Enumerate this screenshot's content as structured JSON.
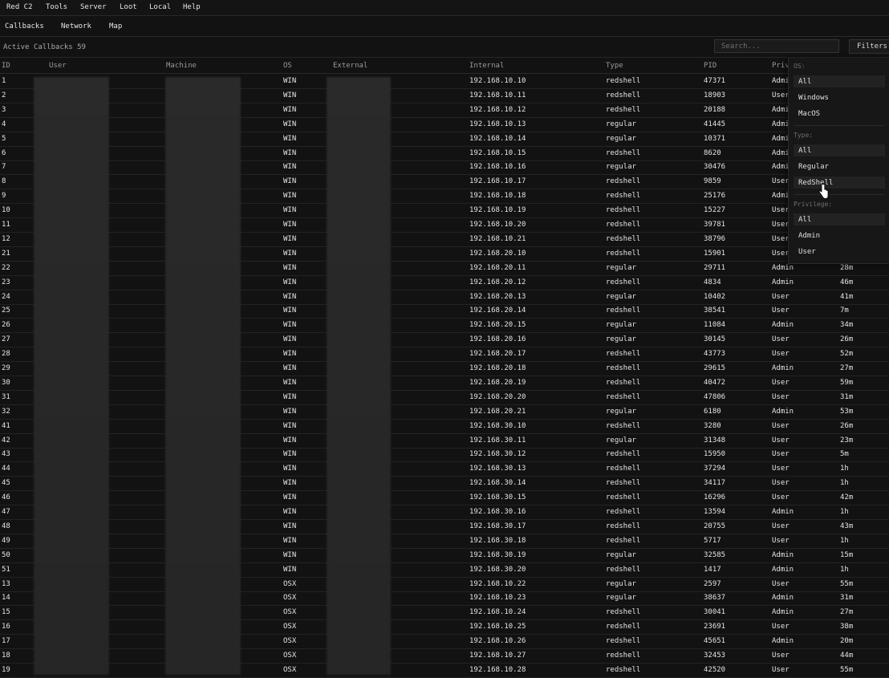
{
  "menu": [
    "Red C2",
    "Tools",
    "Server",
    "Loot",
    "Local",
    "Help"
  ],
  "tabs": [
    "Callbacks",
    "Network",
    "Map"
  ],
  "toolbar": {
    "active_label": "Active Callbacks 59",
    "search_placeholder": "Search...",
    "filters_label": "Filters"
  },
  "columns": [
    "ID",
    "User",
    "Machine",
    "OS",
    "External",
    "Internal",
    "Type",
    "PID",
    "Priv"
  ],
  "rows": [
    [
      "1",
      "WIN",
      "192.168.10.10",
      "redshell",
      "47371",
      "Admi",
      ""
    ],
    [
      "2",
      "WIN",
      "192.168.10.11",
      "redshell",
      "18903",
      "User",
      ""
    ],
    [
      "3",
      "WIN",
      "192.168.10.12",
      "redshell",
      "20188",
      "Admi",
      ""
    ],
    [
      "4",
      "WIN",
      "192.168.10.13",
      "regular",
      "41445",
      "Admi",
      ""
    ],
    [
      "5",
      "WIN",
      "192.168.10.14",
      "regular",
      "10371",
      "Admi",
      ""
    ],
    [
      "6",
      "WIN",
      "192.168.10.15",
      "redshell",
      "8620",
      "Admi",
      ""
    ],
    [
      "7",
      "WIN",
      "192.168.10.16",
      "regular",
      "30476",
      "Admi",
      ""
    ],
    [
      "8",
      "WIN",
      "192.168.10.17",
      "redshell",
      "9859",
      "User",
      ""
    ],
    [
      "9",
      "WIN",
      "192.168.10.18",
      "redshell",
      "25176",
      "Admi",
      ""
    ],
    [
      "10",
      "WIN",
      "192.168.10.19",
      "redshell",
      "15227",
      "User",
      ""
    ],
    [
      "11",
      "WIN",
      "192.168.10.20",
      "redshell",
      "39781",
      "User",
      ""
    ],
    [
      "12",
      "WIN",
      "192.168.10.21",
      "redshell",
      "38796",
      "User",
      ""
    ],
    [
      "21",
      "WIN",
      "192.168.20.10",
      "redshell",
      "15901",
      "User",
      ""
    ],
    [
      "22",
      "WIN",
      "192.168.20.11",
      "regular",
      "29711",
      "Admin",
      "28m"
    ],
    [
      "23",
      "WIN",
      "192.168.20.12",
      "redshell",
      "4834",
      "Admin",
      "46m"
    ],
    [
      "24",
      "WIN",
      "192.168.20.13",
      "regular",
      "10402",
      "User",
      "41m"
    ],
    [
      "25",
      "WIN",
      "192.168.20.14",
      "redshell",
      "38541",
      "User",
      "7m"
    ],
    [
      "26",
      "WIN",
      "192.168.20.15",
      "regular",
      "11084",
      "Admin",
      "34m"
    ],
    [
      "27",
      "WIN",
      "192.168.20.16",
      "regular",
      "30145",
      "User",
      "26m"
    ],
    [
      "28",
      "WIN",
      "192.168.20.17",
      "redshell",
      "43773",
      "User",
      "52m"
    ],
    [
      "29",
      "WIN",
      "192.168.20.18",
      "redshell",
      "29615",
      "Admin",
      "27m"
    ],
    [
      "30",
      "WIN",
      "192.168.20.19",
      "redshell",
      "40472",
      "User",
      "59m"
    ],
    [
      "31",
      "WIN",
      "192.168.20.20",
      "redshell",
      "47806",
      "User",
      "31m"
    ],
    [
      "32",
      "WIN",
      "192.168.20.21",
      "regular",
      "6180",
      "Admin",
      "53m"
    ],
    [
      "41",
      "WIN",
      "192.168.30.10",
      "redshell",
      "3280",
      "User",
      "26m"
    ],
    [
      "42",
      "WIN",
      "192.168.30.11",
      "regular",
      "31348",
      "User",
      "23m"
    ],
    [
      "43",
      "WIN",
      "192.168.30.12",
      "redshell",
      "15950",
      "User",
      "5m"
    ],
    [
      "44",
      "WIN",
      "192.168.30.13",
      "redshell",
      "37294",
      "User",
      "1h"
    ],
    [
      "45",
      "WIN",
      "192.168.30.14",
      "redshell",
      "34117",
      "User",
      "1h"
    ],
    [
      "46",
      "WIN",
      "192.168.30.15",
      "redshell",
      "16296",
      "User",
      "42m"
    ],
    [
      "47",
      "WIN",
      "192.168.30.16",
      "redshell",
      "13594",
      "Admin",
      "1h"
    ],
    [
      "48",
      "WIN",
      "192.168.30.17",
      "redshell",
      "20755",
      "User",
      "43m"
    ],
    [
      "49",
      "WIN",
      "192.168.30.18",
      "redshell",
      "5717",
      "User",
      "1h"
    ],
    [
      "50",
      "WIN",
      "192.168.30.19",
      "regular",
      "32585",
      "Admin",
      "15m"
    ],
    [
      "51",
      "WIN",
      "192.168.30.20",
      "redshell",
      "1417",
      "Admin",
      "1h"
    ],
    [
      "13",
      "OSX",
      "192.168.10.22",
      "regular",
      "2597",
      "User",
      "55m"
    ],
    [
      "14",
      "OSX",
      "192.168.10.23",
      "regular",
      "38637",
      "Admin",
      "31m"
    ],
    [
      "15",
      "OSX",
      "192.168.10.24",
      "redshell",
      "30041",
      "Admin",
      "27m"
    ],
    [
      "16",
      "OSX",
      "192.168.10.25",
      "redshell",
      "23691",
      "User",
      "38m"
    ],
    [
      "17",
      "OSX",
      "192.168.10.26",
      "redshell",
      "45651",
      "Admin",
      "20m"
    ],
    [
      "18",
      "OSX",
      "192.168.10.27",
      "redshell",
      "32453",
      "User",
      "44m"
    ],
    [
      "19",
      "OSX",
      "192.168.10.28",
      "redshell",
      "42520",
      "User",
      "55m"
    ]
  ],
  "filters": {
    "os_label": "OS:",
    "os_options": [
      "All",
      "Windows",
      "MacOS"
    ],
    "type_label": "Type:",
    "type_options": [
      "All",
      "Regular",
      "RedShell"
    ],
    "priv_label": "Privilege:",
    "priv_options": [
      "All",
      "Admin",
      "User"
    ]
  }
}
